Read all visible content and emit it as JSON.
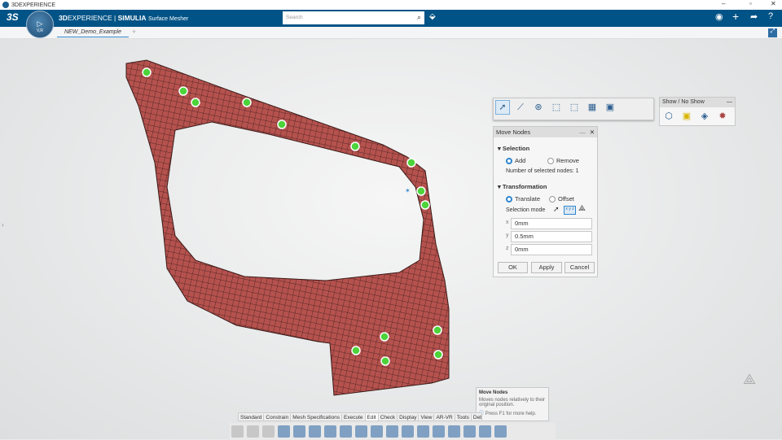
{
  "window": {
    "title": "3DEXPERIENCE",
    "controls": [
      "minimize",
      "maximize",
      "close"
    ]
  },
  "topbar": {
    "brand_bold": "3D",
    "brand_rest": "EXPERIENCE | ",
    "brand_app": "SIMULIA",
    "app_name": "Surface Mesher",
    "compass_label": "V,R",
    "search_placeholder": "Search",
    "icons": [
      "3ds-logo",
      "search-icon",
      "tag-icon",
      "user-icon",
      "plus-icon",
      "share-icon",
      "help-icon"
    ]
  },
  "tabs": {
    "items": [
      {
        "label": "NEW_Demo_Example",
        "active": true
      }
    ],
    "add": "+"
  },
  "show_noshow": {
    "title": "Show / No Show",
    "minimize": "—"
  },
  "move_nodes": {
    "title": "Move Nodes",
    "minimize": "—",
    "close": "✕",
    "selection": {
      "heading": "Selection",
      "options": [
        {
          "label": "Add",
          "selected": true
        },
        {
          "label": "Remove",
          "selected": false
        }
      ],
      "count_text": "Number of selected nodes: 1"
    },
    "transformation": {
      "heading": "Transformation",
      "options": [
        {
          "label": "Translate",
          "selected": true
        },
        {
          "label": "Offset",
          "selected": false
        }
      ],
      "mode_label": "Selection mode",
      "mode_xyz": "x y z"
    },
    "fields": [
      {
        "axis": "x",
        "value": "0mm"
      },
      {
        "axis": "y",
        "value": "0.5mm"
      },
      {
        "axis": "z",
        "value": "0mm"
      }
    ],
    "buttons": {
      "ok": "OK",
      "apply": "Apply",
      "cancel": "Cancel"
    }
  },
  "tooltip": {
    "title": "Move Nodes",
    "description": "Moves nodes relatively to their original position.",
    "help": "Press F1 for more help."
  },
  "action_bar": {
    "tabs": [
      "Standard",
      "Constrain",
      "Mesh Specifications",
      "Execute",
      "Edit",
      "Check",
      "Display",
      "View",
      "AR-VR",
      "Tools",
      "Debu"
    ],
    "active_tab": "Edit"
  },
  "colors": {
    "mesh": "#b5524e",
    "node": "#4cd43a",
    "topbar": "#005386",
    "accent": "#2e86d0"
  }
}
